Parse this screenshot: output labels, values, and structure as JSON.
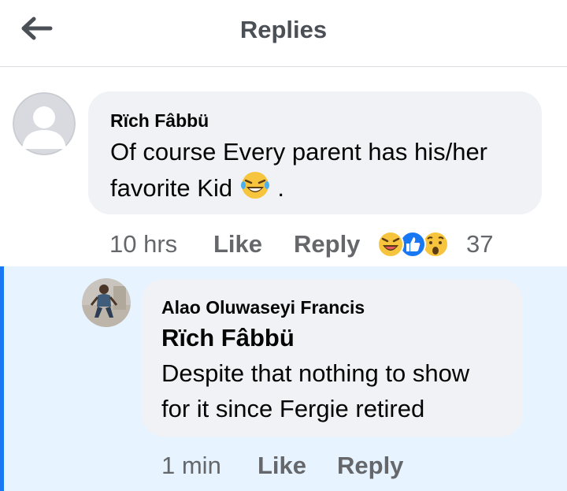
{
  "header": {
    "title": "Replies",
    "back_icon": "arrow-left-icon"
  },
  "comments": [
    {
      "author": "Rïch Fâbbü",
      "text_line1": "Of course Every parent has his/her",
      "text_line2": "favorite Kid",
      "text_end": ".",
      "time": "10 hrs",
      "like_label": "Like",
      "reply_label": "Reply",
      "reaction_count": "37",
      "reactions": [
        "haha-icon",
        "like-icon",
        "wow-icon"
      ]
    }
  ],
  "reply": {
    "author": "Alao Oluwaseyi Francis",
    "mention": "Rïch Fâbbü",
    "text_line1": "Despite that nothing to show",
    "text_line2": "for it since Fergie retired",
    "time": "1 min",
    "like_label": "Like",
    "reply_label": "Reply"
  },
  "colors": {
    "accent": "#1877f2",
    "reply_bg": "#e7f3ff",
    "bubble_bg": "#f0f2f5",
    "meta_text": "#65676b"
  }
}
